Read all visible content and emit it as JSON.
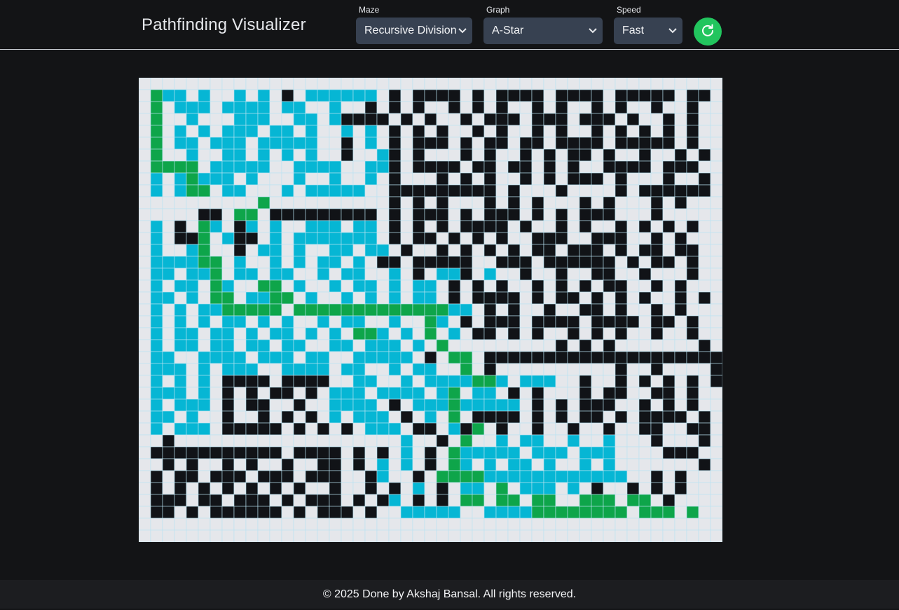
{
  "app": {
    "title": "Pathfinding Visualizer"
  },
  "controls": {
    "maze": {
      "label": "Maze",
      "value": "Recursive Division"
    },
    "graph": {
      "label": "Graph",
      "value": "A-Star"
    },
    "speed": {
      "label": "Speed",
      "value": "Fast"
    },
    "reset_icon": "refresh-icon"
  },
  "footer": {
    "text": "© 2025 Done by Akshaj Bansal. All rights reserved."
  },
  "colors": {
    "background": "#131416",
    "empty": "#e5e7eb",
    "gridline": "#b9e3f2",
    "wall": "#111317",
    "visited": "#06b6d4",
    "path": "#0ea54a",
    "start": "#0ea54a",
    "end": "#e11d24",
    "accent": "#22c55e"
  },
  "grid": {
    "rows": 39,
    "cols": 49,
    "legend": {
      ".": "empty",
      "#": "wall",
      "v": "visited",
      "p": "path",
      "S": "start",
      "E": "end"
    },
    "cells": [
      ".................................................",
      ".Svv.v..v.v.#.vvvvvv.#.####.#.####.####.#####.##.",
      ".p.vvv.vvvv.vv..v..#.#.#..#.#.#..#.#..#.#..#..#.",
      ".p..v...vvv..vv.v####.#.#..#.###.###.###.#..#.#.",
      ".p.v.v.vvv.vv.v..v.v.#.#.#..#.#..#.#..#.#.#.#.#.",
      ".p.vv.vvv.vvvvv..#.v.#.###.#.##.##.####.#####.#.",
      ".p..v..vv.v.v.v..#..v#.#...#.#..#.#.##.#..#..#.#.",
      ".pppp.vvvvv..vvvv..vv#.####.##.##.#.#..####.###.",
      ".v.vpvvv.v...v..v..v.#...#.#.#..#.#.###.#...#..#.",
      ".v.vpp.vv...v.vvvvv..#########.#...#....#.######.",
      "..........p..........#.#.#...#.#.#...#.#...#.#..",
      ".....##.pp.#########.#.###.#.###.#.#.###...#....",
      ".v.#.pv.#v.v..vvv.vv.#.#.#.####.#..#.#..#.#.#.#.",
      ".v.##p.v##.v.vvvvvvv.#.##.#.#.#..###..###..#.#.",
      ".v..vp..#.vv.v..vv.vv.#..#.#.#.#.##.###.#.##.##.",
      ".vvvvpp.v..v.v.vv.v.##.#####..###.######.#.##.#.",
      ".vv.vvp.vv.vv..v.vv..v.#.vv#.v..#..#..##..#...#.",
      ".v.vv.pv..pp.v..v.vv.v.vv.#.#.#..#.#.#.##..#.#.",
      ".vv.v.pp.vvpp.v..v.v.v.vv.#.####.#.##.#.#.#..#.#.",
      ".v.v.vvppppp.pppppppppppppvv.#.#..#..##.#..#.#.",
      ".v.v.v.vv.v.v..v.vv..v..pv.#.###.####.####.##.#.",
      ".v.vv.vv.v.vv.v.v.ppv.v.p.v.##.#.#..#.#.#..#..#.",
      ".v.vv.vv.vv.vv..vv.vvv.v.p.........#.#.#.......#.",
      ".vv..vvvv.vvv.vv..vvvvv.#.pp.##########################",
      ".vvv.v.vvv..vvvv.vv..v.vv..p.#..........#..#....#.#.",
      ".v.v.v.####.####..vv..v.vvvvppv.vvv..#..#.#.#.#.###",
      ".vvv.v.#.#.##.#.vvv.vvvv.vp.vv.#.#...#.##..##.#...#",
      ".v.vvv.#.##..#..vvvv.#.vvvpvvvvv.#.#.###..#.#.#..#.",
      ".vv.v..#..#.#.#.v.vvv.#.v.p.####.#.#.##.#.####.#.#",
      ".v.vvv.#####.#.#.#.vvv.##.v#p.#..#..#..#..##..##.#",
      "..#...................v..#.p..v.vv..v..v...#...#.#.",
      ".###########.####.#.#.v.#.pvvvvv.vvv.vvv....###..",
      "..#.#..#.#..#..##.#.v.v.#.pv.v.vv.v..v.v.......#.",
      ".#.##.###.###.###..#v..#.ppppvvvvvvvvvvvv..#.#.",
      ".#.#.#.#.#.#.#..#..#.#.v.#.vv.p.vvv.v.#..#.#.#.",
      ".###.##.###.#.###.#.#v.#.#.pp.pp.pp..ppp.pp.#.",
      ".##.#.######.#.###.#..vvvvv..vvvvpppppppp.ppp.p..pE",
      "................................................."
    ]
  }
}
